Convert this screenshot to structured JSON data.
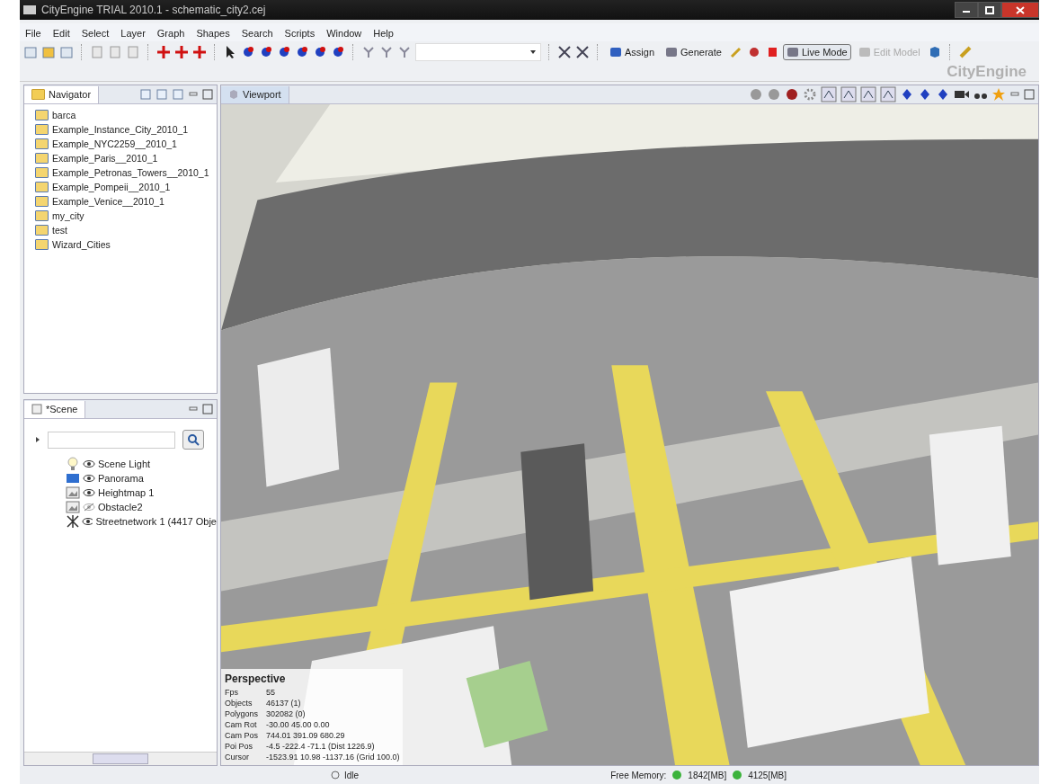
{
  "window": {
    "title": "CityEngine TRIAL 2010.1 - schematic_city2.cej"
  },
  "menu": [
    "File",
    "Edit",
    "Select",
    "Layer",
    "Graph",
    "Shapes",
    "Search",
    "Scripts",
    "Window",
    "Help"
  ],
  "toolbar": {
    "buttons": [
      {
        "label": "Assign",
        "selected": false,
        "disabled": false
      },
      {
        "label": "Generate",
        "selected": false,
        "disabled": false
      },
      {
        "label": "Live Mode",
        "selected": true,
        "disabled": false
      },
      {
        "label": "Edit Model",
        "selected": false,
        "disabled": true
      }
    ],
    "brand": "CityEngine"
  },
  "navigator": {
    "tab": "Navigator",
    "items": [
      "barca",
      "Example_Instance_City_2010_1",
      "Example_NYC2259__2010_1",
      "Example_Paris__2010_1",
      "Example_Petronas_Towers__2010_1",
      "Example_Pompeii__2010_1",
      "Example_Venice__2010_1",
      "my_city",
      "test",
      "Wizard_Cities"
    ]
  },
  "scene": {
    "tab": "*Scene",
    "items": [
      {
        "label": "Scene Light",
        "kind": "light",
        "visible": true
      },
      {
        "label": "Panorama",
        "kind": "panorama",
        "visible": true
      },
      {
        "label": "Heightmap 1",
        "kind": "heightmap",
        "visible": true
      },
      {
        "label": "Obstacle2",
        "kind": "heightmap",
        "visible": false
      },
      {
        "label": "Streetnetwork 1 (4417 Obje",
        "kind": "network",
        "visible": true
      }
    ]
  },
  "viewport": {
    "tab": "Viewport",
    "stats": {
      "title": "Perspective",
      "rows": [
        {
          "label": "Fps",
          "value": "55"
        },
        {
          "label": "Objects",
          "value": "46137 (1)"
        },
        {
          "label": "Polygons",
          "value": "302082 (0)"
        },
        {
          "label": "Cam Rot",
          "value": "-30.00 45.00 0.00"
        },
        {
          "label": "Cam Pos",
          "value": "744.01 391.09 680.29"
        },
        {
          "label": "Poi Pos",
          "value": "-4.5 -222.4 -71.1 (Dist 1226.9)"
        },
        {
          "label": "Cursor",
          "value": "-1523.91 10.98 -1137.16 (Grid 100.0)"
        }
      ]
    }
  },
  "status_bar": {
    "state": "Idle",
    "memory_label": "Free Memory:",
    "memory": [
      "1842[MB]",
      "4125[MB]"
    ]
  }
}
